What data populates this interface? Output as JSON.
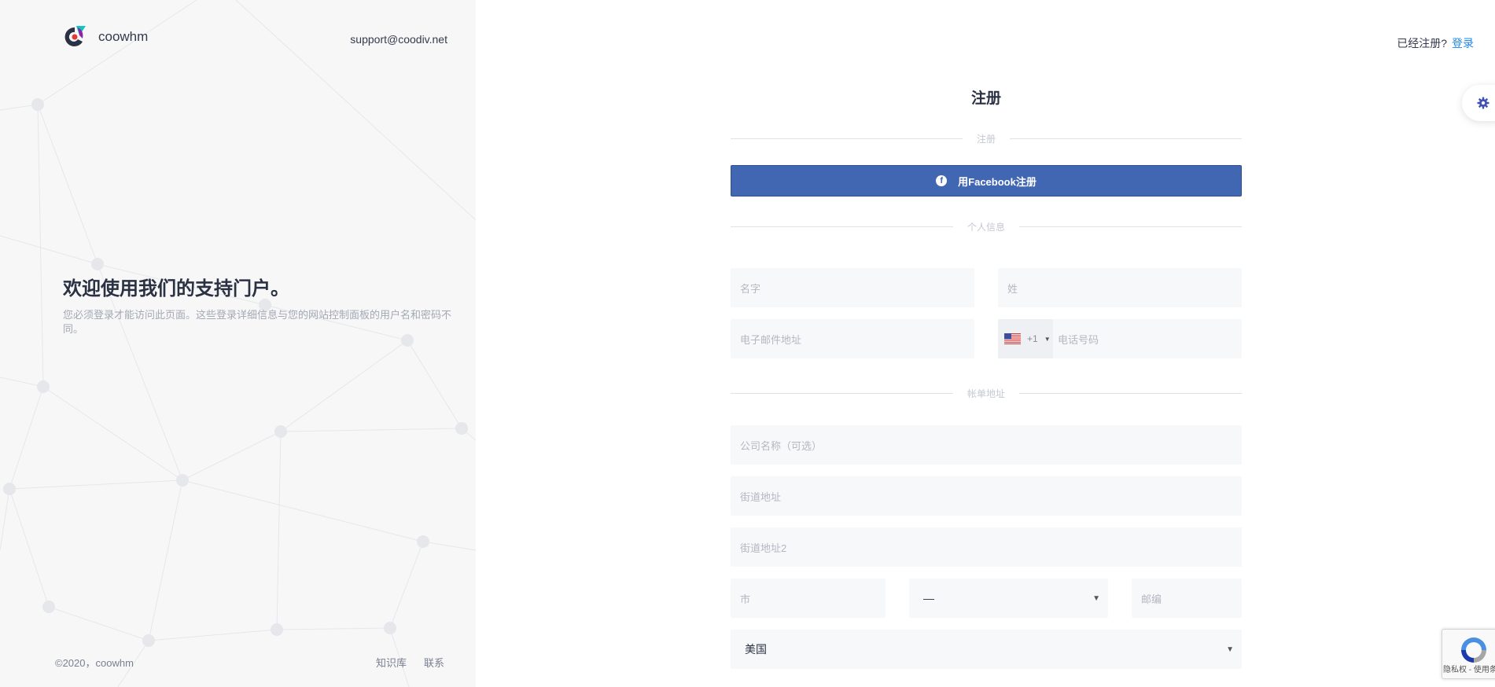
{
  "brand": {
    "name": "coowhm"
  },
  "support_email": "support@coodiv.net",
  "welcome": {
    "title": "欢迎使用我们的支持门户。",
    "text": "您必须登录才能访问此页面。这些登录详细信息与您的网站控制面板的用户名和密码不同。"
  },
  "footer": {
    "copyright": "©2020，coowhm",
    "links": [
      "知识库",
      "联系"
    ]
  },
  "header": {
    "already_text": "已经注册?",
    "login_link": "登录"
  },
  "form": {
    "title": "注册",
    "divider_signup": "注册",
    "facebook_button": "用Facebook注册",
    "divider_personal": "个人信息",
    "first_name_placeholder": "名字",
    "last_name_placeholder": "姓",
    "email_placeholder": "电子邮件地址",
    "phone_code": "+1",
    "phone_placeholder": "电话号码",
    "divider_billing": "帐单地址",
    "company_placeholder": "公司名称（可选）",
    "street_placeholder": "街道地址",
    "street2_placeholder": "街道地址2",
    "city_placeholder": "市",
    "state_value": "—",
    "postcode_placeholder": "邮编",
    "country_value": "美国"
  },
  "recaptcha": {
    "text": "隐私权 - 使用条款"
  },
  "icons": [
    "coowhm-logo-icon",
    "facebook-icon",
    "us-flag-icon",
    "gear-icon",
    "recaptcha-icon"
  ],
  "colors": {
    "facebook": "#4267b2",
    "link": "#1e88e5",
    "gear": "#3f51b5"
  }
}
